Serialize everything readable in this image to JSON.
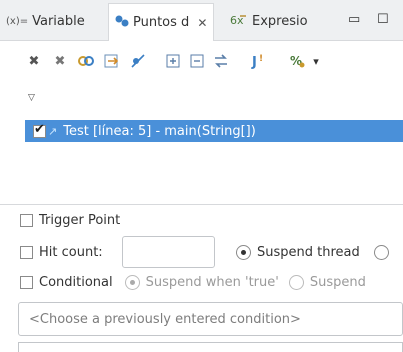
{
  "tabs": [
    {
      "prefix": "(x)=",
      "label": "Variable",
      "active": false
    },
    {
      "label": "Puntos d",
      "close": "✕",
      "active": true
    },
    {
      "label": "Expresio",
      "active": false
    }
  ],
  "window_buttons": {
    "minimize": "▭",
    "maximize": "☐"
  },
  "toolbar": {
    "icons": [
      "remove-icon",
      "remove-all-icon",
      "link-icon",
      "export-icon",
      "skip-icon",
      "expand-all-icon",
      "collapse-all-icon",
      "group-icon",
      "java-exception-icon",
      "more-icon"
    ],
    "dropdown": "▾"
  },
  "tree": {
    "collapse_glyph": "▽"
  },
  "breakpoints": [
    {
      "label": "Test [línea: 5] - main(String[])",
      "checked": true,
      "selected": true
    }
  ],
  "detail": {
    "trigger_point": {
      "label": "Trigger Point",
      "checked": false
    },
    "hit_count": {
      "label": "Hit count:",
      "checked": false,
      "value": ""
    },
    "suspend_thread": {
      "label": "Suspend thread",
      "selected": true
    },
    "conditional": {
      "label": "Conditional",
      "checked": false
    },
    "suspend_when_true": {
      "label": "Suspend when 'true'",
      "selected": true
    },
    "suspend_when_changed": {
      "label": "Suspend"
    },
    "condition_placeholder": "<Choose a previously entered condition>"
  },
  "colors": {
    "selection": "#4a90d9",
    "tabbar": "#eef0f2",
    "border": "#c3c6ca"
  }
}
